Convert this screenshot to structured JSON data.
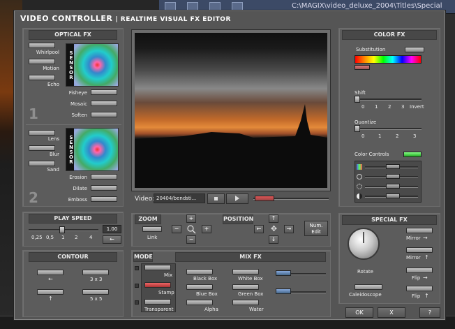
{
  "background": {
    "path_text": "C:\\MAGIX\\video_deluxe_2004\\Titles\\Special"
  },
  "window": {
    "title": "VIDEO CONTROLLER",
    "subtitle": "| REALTIME VISUAL FX EDITOR"
  },
  "optical_fx": {
    "header": "OPTICAL FX",
    "sensor_label": "SENSOR",
    "set1_number": "1",
    "set2_number": "2",
    "set1_left": [
      "Whirlpool",
      "Motion",
      "Echo"
    ],
    "set1_right": [
      "Fisheye",
      "Mosaic",
      "Soften"
    ],
    "set2_left": [
      "Lens",
      "Blur",
      "Sand"
    ],
    "set2_right": [
      "Erosion",
      "Dilate",
      "Emboss"
    ]
  },
  "preview": {
    "video_label": "Video:",
    "video_file": "20404/bendsti..."
  },
  "color_fx": {
    "header": "COLOR FX",
    "substitution_label": "Substitution",
    "shift_label": "Shift",
    "shift_ticks": [
      "0",
      "1",
      "2",
      "3",
      "Invert"
    ],
    "quantize_label": "Quantize",
    "quantize_ticks": [
      "0",
      "1",
      "2",
      "3"
    ],
    "color_controls_label": "Color Controls"
  },
  "play_speed": {
    "header": "PLAY SPEED",
    "value": "1.00",
    "ticks": [
      "0,25",
      "0,5",
      "1",
      "2",
      "4"
    ],
    "reset_symbol": "←"
  },
  "zoom": {
    "header": "ZOOM",
    "link_label": "Link"
  },
  "position": {
    "header": "POSITION",
    "num_edit_label": "Num.\nEdit"
  },
  "special_fx": {
    "header": "SPECIAL FX",
    "rotate_label": "Rotate",
    "caleidoscope_label": "Caleidoscope",
    "mirror_h_label": "Mirror",
    "mirror_v_label": "Mirror",
    "flip_h_label": "Flip",
    "flip_v_label": "Flip"
  },
  "contour": {
    "header": "CONTOUR",
    "items": [
      "←",
      "3 x 3",
      "↑",
      "5 x 5"
    ]
  },
  "mix_fx": {
    "mode_header": "MODE",
    "header": "MIX FX",
    "modes": [
      "Mix",
      "Stamp",
      "Transparent"
    ],
    "boxes": [
      "Black Box",
      "Blue Box",
      "Alpha",
      "White Box",
      "Green Box",
      "Water"
    ]
  },
  "footer": {
    "ok": "OK",
    "cancel": "X",
    "help": "?"
  },
  "colors": {
    "window_bg": "#555555",
    "panel_bg": "#5c5c5c",
    "active_led": "#4fd24f",
    "stamp_red": "#e44a4a"
  }
}
